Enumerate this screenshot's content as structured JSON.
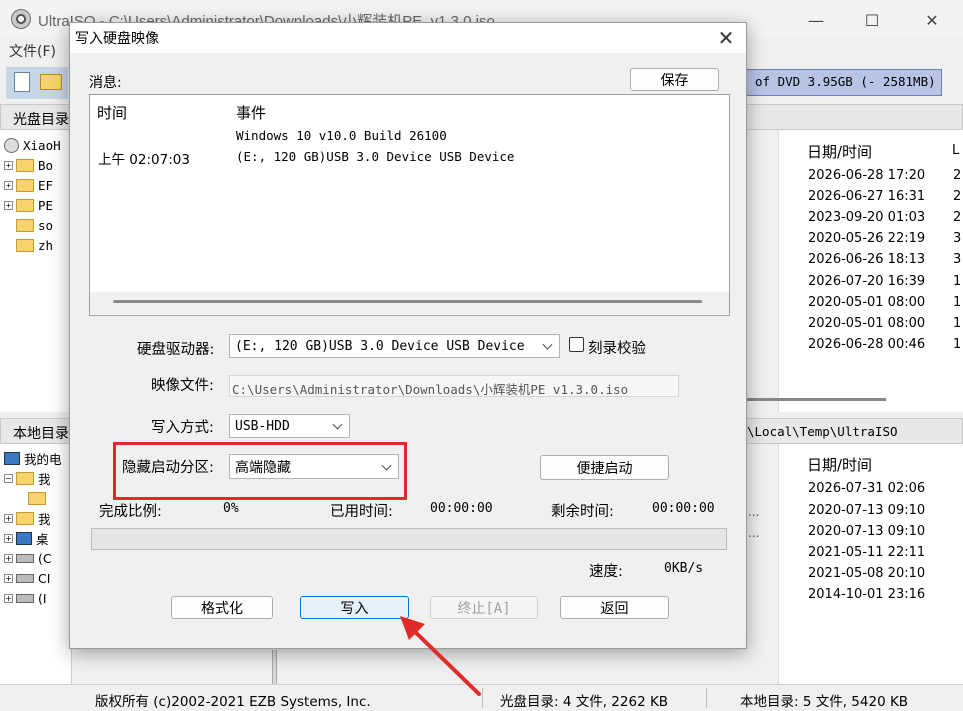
{
  "main": {
    "title": "UltraISO - C:\\Users\\Administrator\\Downloads\\小辉装机PE_v1.3.0.iso",
    "menu_file": "文件(F)",
    "dvd_capacity": "of DVD 3.95GB (- 2581MB)",
    "cd_pane_title": "光盘目录",
    "local_pane_title": "本地目录",
    "local_path": "\\Local\\Temp\\UltraISO",
    "cd_tree": [
      "XiaoH",
      "Bo",
      "EF",
      "PE",
      "so",
      "zh"
    ],
    "local_tree": [
      "我的电",
      "我",
      "",
      "我",
      "桌",
      "(C",
      "CI",
      "(I"
    ],
    "date_header": "日期/时间",
    "extra_header": "L",
    "cd_dates": [
      "2026-06-28 17:20",
      "2026-06-27 16:31",
      "2023-09-20 01:03",
      "2020-05-26 22:19",
      "2026-06-26 18:13",
      "2026-07-20 16:39",
      "2020-05-01 08:00",
      "2020-05-01 08:00",
      "2026-06-28 00:46"
    ],
    "cd_extra": [
      "2",
      "2",
      "2",
      "3",
      "3",
      "1",
      "1",
      "1",
      "1"
    ],
    "local_dates": [
      "2026-07-31 02:06",
      "2020-07-13 09:10",
      "2020-07-13 09:10",
      "2021-05-11 22:11",
      "2021-05-08 20:10",
      "2014-10-01 23:16"
    ],
    "dots": "...",
    "status": {
      "copyright": "版权所有 (c)2002-2021 EZB Systems, Inc.",
      "cd_summary": "光盘目录: 4 文件, 2262 KB",
      "local_summary": "本地目录: 5 文件, 5420 KB"
    }
  },
  "dialog": {
    "title": "写入硬盘映像",
    "close": "✕",
    "messages_label": "消息:",
    "save_button": "保存",
    "log": {
      "col_time": "时间",
      "col_event": "事件",
      "time": "上午 02:07:03",
      "event_line1": "Windows 10 v10.0 Build 26100",
      "event_line2": "(E:, 120 GB)USB 3.0 Device USB Device"
    },
    "drive_label": "硬盘驱动器:",
    "drive_value": "(E:, 120 GB)USB 3.0 Device USB Device",
    "verify_label": "刻录校验",
    "image_label": "映像文件:",
    "image_value": "C:\\Users\\Administrator\\Downloads\\小辉装机PE_v1.3.0.iso",
    "method_label": "写入方式:",
    "method_value": "USB-HDD",
    "hide_label": "隐藏启动分区:",
    "hide_value": "高端隐藏",
    "quick_boot_button": "便捷启动",
    "progress_label": "完成比例:",
    "progress_value": "0%",
    "elapsed_label": "已用时间:",
    "elapsed_value": "00:00:00",
    "remaining_label": "剩余时间:",
    "remaining_value": "00:00:00",
    "progress_fraction": 0,
    "speed_label": "速度:",
    "speed_value": "0KB/s",
    "buttons": {
      "format": "格式化",
      "write": "写入",
      "stop": "终止[A]",
      "back": "返回"
    }
  },
  "colors": {
    "highlight": "#e02b2b",
    "primary_border": "#0078d4",
    "dvd_box": "#b9c3e6"
  }
}
